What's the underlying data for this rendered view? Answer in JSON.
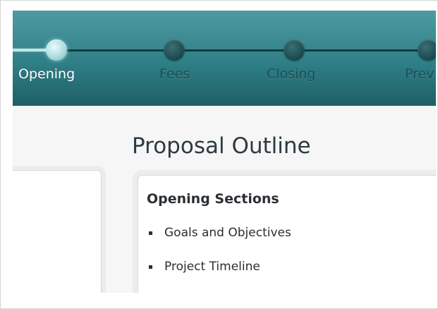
{
  "wizard": {
    "steps": [
      {
        "label": "Opening",
        "active": true
      },
      {
        "label": "Fees",
        "active": false
      },
      {
        "label": "Closing",
        "active": false
      },
      {
        "label": "Prev",
        "active": false
      }
    ]
  },
  "main": {
    "title": "Proposal Outline",
    "outline": {
      "section_title": "Opening Sections",
      "items": [
        "Goals and Objectives",
        "Project Timeline"
      ]
    }
  },
  "colors": {
    "header_teal": "#2f7f87",
    "active_step_label": "#ffffff",
    "inactive_step_label": "#1b4e54"
  }
}
